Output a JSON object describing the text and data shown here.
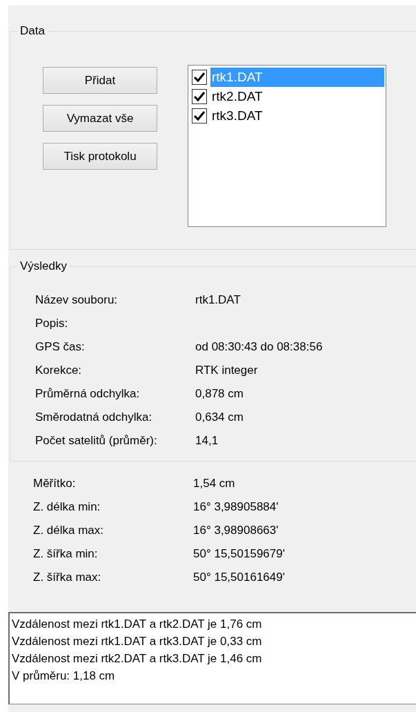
{
  "data_group": {
    "title": "Data",
    "buttons": [
      "Přidat",
      "Vymazat vše",
      "Tisk protokolu"
    ],
    "files": [
      {
        "label": "rtk1.DAT",
        "checked": true,
        "selected": true
      },
      {
        "label": "rtk2.DAT",
        "checked": true,
        "selected": false
      },
      {
        "label": "rtk3.DAT",
        "checked": true,
        "selected": false
      }
    ]
  },
  "results_group": {
    "title": "Výsledky",
    "rows": [
      {
        "label": "Název souboru:",
        "value": "rtk1.DAT"
      },
      {
        "label": "Popis:"
      },
      {
        "label": "GPS čas:",
        "value": "od 08:30:43 do 08:38:56"
      },
      {
        "label": "Korekce:",
        "value": "RTK integer"
      },
      {
        "label": "Průměrná odchylka:",
        "value": "0,878 cm"
      },
      {
        "label": "Směrodatná odchylka:",
        "value": "0,634 cm"
      },
      {
        "label": "Počet satelitů (průměr):",
        "value": "14,1"
      }
    ]
  },
  "extent_rows": [
    {
      "label": "Měřítko:",
      "value": "1,54 cm"
    },
    {
      "label": "Z. délka min:",
      "value": "16° 3,98905884'"
    },
    {
      "label": "Z. délka max:",
      "value": "16° 3,98908663'"
    },
    {
      "label": "Z. šířka min:",
      "value": "50° 15,50159679'"
    },
    {
      "label": "Z. šířka max:",
      "value": "50° 15,50161649'"
    }
  ],
  "log_lines": [
    "Vzdálenost mezi rtk1.DAT a rtk2.DAT je 1,76 cm",
    "Vzdálenost mezi rtk1.DAT a rtk3.DAT je 0,33 cm",
    "Vzdálenost mezi rtk2.DAT a rtk3.DAT je 1,46 cm",
    "V průměru: 1,18 cm"
  ]
}
